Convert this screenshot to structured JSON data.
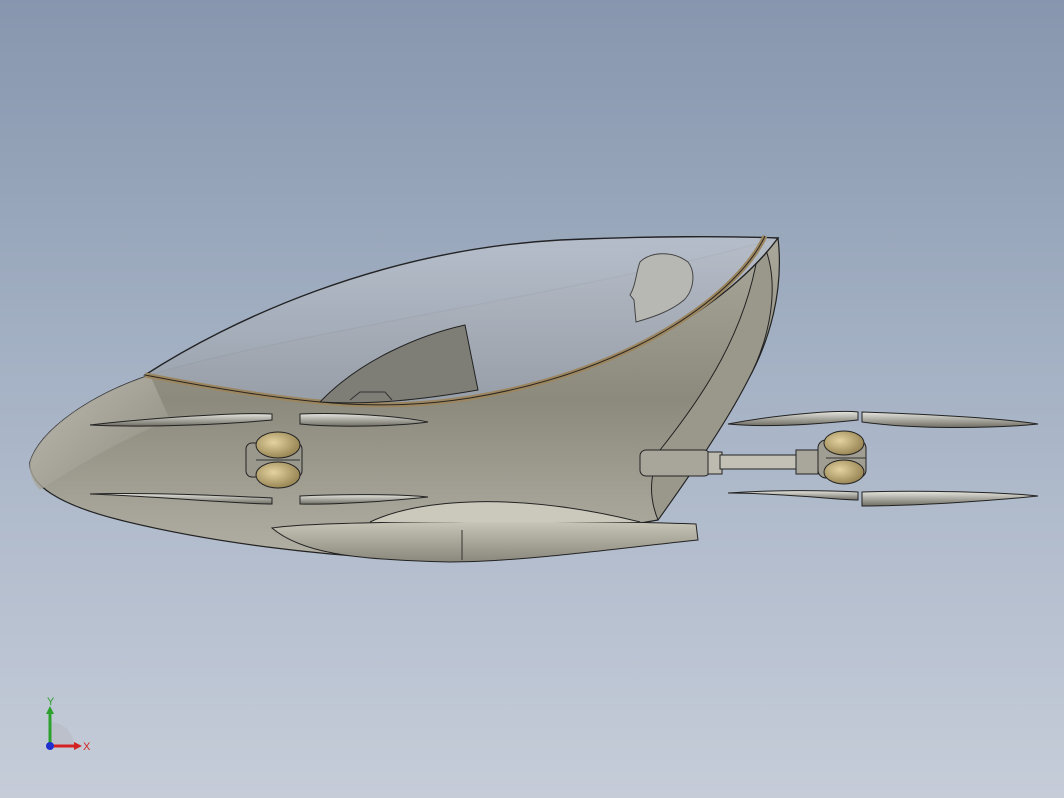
{
  "viewport": {
    "background_top": "#8796ae",
    "background_bottom": "#c6cdd9"
  },
  "model": {
    "body_color": "#8f8d80",
    "canopy_color": "#a9b2bf",
    "trim_color": "#9c8660",
    "hub_color": "#b8a06a"
  },
  "triad": {
    "x_label": "X",
    "y_label": "Y",
    "x_color": "#d42222",
    "y_color": "#2ca02c",
    "z_color": "#1f2fd0"
  }
}
